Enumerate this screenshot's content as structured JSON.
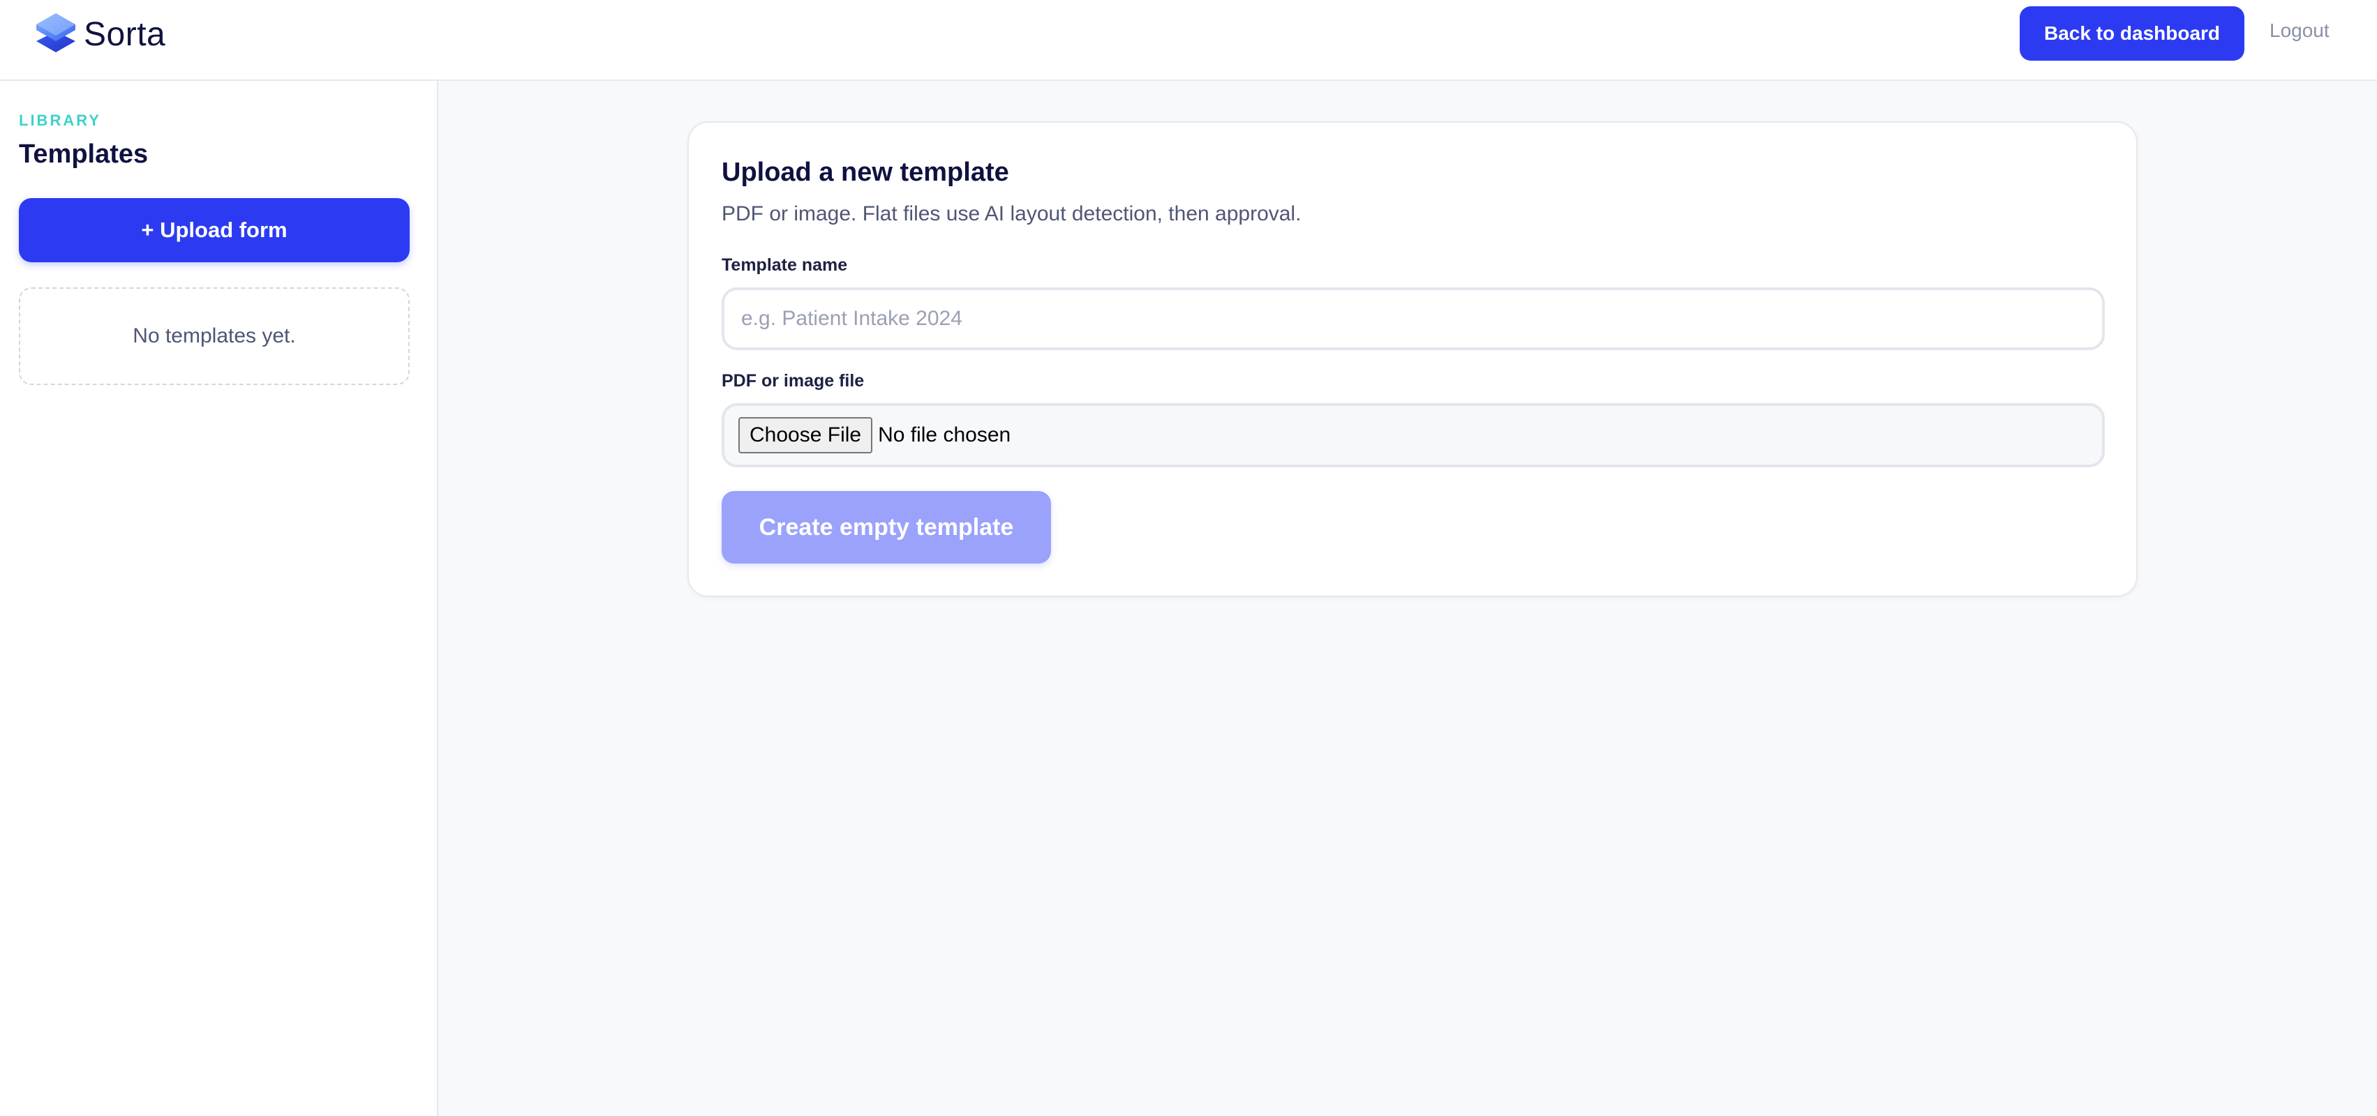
{
  "app": {
    "name": "Sorta",
    "logo_icon": "stacked-layers-logo"
  },
  "header": {
    "back_button_label": "Back to dashboard",
    "logout_label": "Logout"
  },
  "sidebar": {
    "eyebrow": "LIBRARY",
    "title": "Templates",
    "upload_button_label": "+ Upload form",
    "empty_message": "No templates yet."
  },
  "upload_card": {
    "title": "Upload a new template",
    "subtitle": "PDF or image. Flat files use AI layout detection, then approval.",
    "name_label": "Template name",
    "name_value": "",
    "name_placeholder": "e.g. Patient Intake 2024",
    "file_label": "PDF or image file",
    "choose_file_label": "Choose File",
    "file_status": "No file chosen",
    "create_button_label": "Create empty template",
    "create_button_disabled": true
  },
  "colors": {
    "primary": "#2c3bf2",
    "primary_disabled": "#9aa2fb",
    "accent_eyebrow": "#3fd1c9",
    "text_dark": "#0f1240",
    "text_muted": "#4f5675",
    "background": "#f8f9fb"
  }
}
